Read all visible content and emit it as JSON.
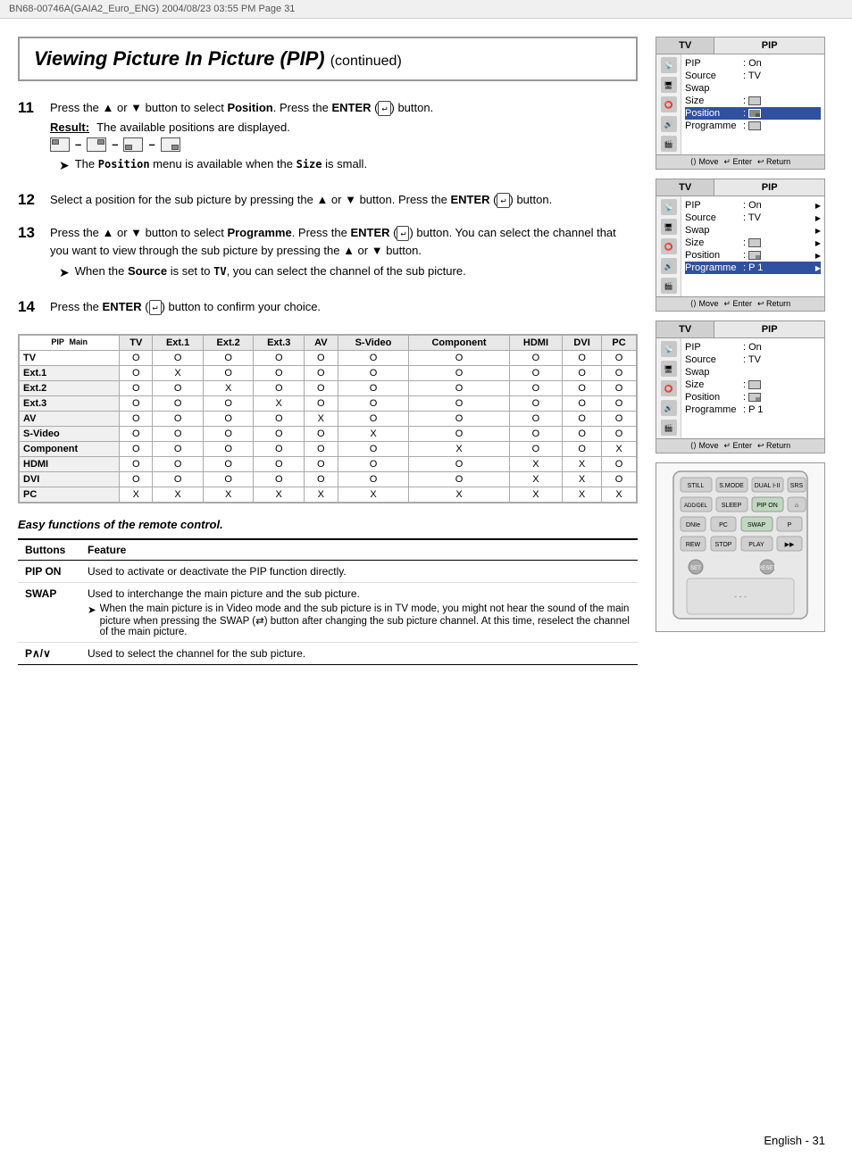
{
  "header": {
    "left_text": "BN68-00746A(GAIA2_Euro_ENG)   2004/08/23   03:55 PM   Page 31"
  },
  "title": {
    "main": "Viewing Picture In Picture (PIP)",
    "continued": "(continued)"
  },
  "steps": [
    {
      "number": "11",
      "text": "Press the ▲ or ▼ button to select Position. Press the ENTER (↵) button.",
      "result_label": "Result:",
      "result_text": "The available positions are displayed.",
      "note": "The Position menu is available when the Size is small."
    },
    {
      "number": "12",
      "text": "Select a position for the sub picture by pressing the ▲ or ▼ button. Press the ENTER (↵) button."
    },
    {
      "number": "13",
      "text": "Press the ▲ or ▼ button to select Programme. Press the ENTER (↵) button. You can select the channel that you want to view through the sub picture by pressing the ▲ or ▼ button.",
      "note": "When the Source is set to TV, you can select the channel of the sub picture."
    },
    {
      "number": "14",
      "text": "Press the ENTER (↵) button to confirm your choice."
    }
  ],
  "pip_table": {
    "corner_label": "PIP  Main",
    "columns": [
      "TV",
      "Ext.1",
      "Ext.2",
      "Ext.3",
      "AV",
      "S-Video",
      "Component",
      "HDMI",
      "DVI",
      "PC"
    ],
    "rows": [
      {
        "label": "TV",
        "values": [
          "O",
          "O",
          "O",
          "O",
          "O",
          "O",
          "O",
          "O",
          "O",
          "O"
        ]
      },
      {
        "label": "Ext.1",
        "values": [
          "O",
          "X",
          "O",
          "O",
          "O",
          "O",
          "O",
          "O",
          "O",
          "O"
        ]
      },
      {
        "label": "Ext.2",
        "values": [
          "O",
          "O",
          "X",
          "O",
          "O",
          "O",
          "O",
          "O",
          "O",
          "O"
        ]
      },
      {
        "label": "Ext.3",
        "values": [
          "O",
          "O",
          "O",
          "X",
          "O",
          "O",
          "O",
          "O",
          "O",
          "O"
        ]
      },
      {
        "label": "AV",
        "values": [
          "O",
          "O",
          "O",
          "O",
          "X",
          "O",
          "O",
          "O",
          "O",
          "O"
        ]
      },
      {
        "label": "S-Video",
        "values": [
          "O",
          "O",
          "O",
          "O",
          "O",
          "X",
          "O",
          "O",
          "O",
          "O"
        ]
      },
      {
        "label": "Component",
        "values": [
          "O",
          "O",
          "O",
          "O",
          "O",
          "O",
          "X",
          "O",
          "O",
          "X"
        ]
      },
      {
        "label": "HDMI",
        "values": [
          "O",
          "O",
          "O",
          "O",
          "O",
          "O",
          "O",
          "X",
          "X",
          "O"
        ]
      },
      {
        "label": "DVI",
        "values": [
          "O",
          "O",
          "O",
          "O",
          "O",
          "O",
          "O",
          "X",
          "X",
          "O"
        ]
      },
      {
        "label": "PC",
        "values": [
          "X",
          "X",
          "X",
          "X",
          "X",
          "X",
          "X",
          "X",
          "X",
          "X"
        ]
      }
    ]
  },
  "remote_section": {
    "title": "Easy functions of the remote control.",
    "col_buttons": "Buttons",
    "col_feature": "Feature",
    "rows": [
      {
        "button": "PIP ON",
        "feature": "Used to activate or deactivate the PIP function directly."
      },
      {
        "button": "SWAP",
        "feature": "Used to interchange the main picture and the sub picture.",
        "note": "When the main picture is in Video mode and the sub picture is in TV mode, you might not hear the sound of the main picture when pressing the SWAP (⇄) button after changing the sub picture channel. At this time, reselect the channel of the main picture."
      },
      {
        "button": "P∧/∨",
        "feature": "Used to select the channel for the sub picture."
      }
    ]
  },
  "osd_panels": [
    {
      "tv_label": "TV",
      "pip_label": "PIP",
      "rows": [
        {
          "label": "PIP",
          "value": ": On",
          "arrow": false
        },
        {
          "label": "Source",
          "value": ": TV",
          "arrow": false
        },
        {
          "label": "Swap",
          "value": "",
          "arrow": false
        },
        {
          "label": "Size",
          "value": ":",
          "arrow": false,
          "has_img": true
        },
        {
          "label": "Position",
          "value": ":",
          "arrow": false,
          "has_img": true,
          "highlight": true
        },
        {
          "label": "Programme",
          "value": ":",
          "arrow": false,
          "has_img": true
        }
      ],
      "footer": "⟨⟩ Move  ↵ Enter  ↩ Return"
    },
    {
      "tv_label": "TV",
      "pip_label": "PIP",
      "rows": [
        {
          "label": "PIP",
          "value": ": On",
          "arrow": true
        },
        {
          "label": "Source",
          "value": ": TV",
          "arrow": true
        },
        {
          "label": "Swap",
          "value": "",
          "arrow": true
        },
        {
          "label": "Size",
          "value": ":",
          "arrow": true,
          "has_img": true
        },
        {
          "label": "Position",
          "value": ":",
          "arrow": true,
          "has_img": true
        },
        {
          "label": "Programme",
          "value": ": P 1",
          "arrow": true,
          "highlight": true
        }
      ],
      "footer": "⟨⟩ Move  ↵ Enter  ↩ Return"
    },
    {
      "tv_label": "TV",
      "pip_label": "PIP",
      "rows": [
        {
          "label": "PIP",
          "value": ": On",
          "arrow": false
        },
        {
          "label": "Source",
          "value": ": TV",
          "arrow": false
        },
        {
          "label": "Swap",
          "value": "",
          "arrow": false
        },
        {
          "label": "Size",
          "value": ":",
          "arrow": false,
          "has_img": true
        },
        {
          "label": "Position",
          "value": ":",
          "arrow": false,
          "has_img": true
        },
        {
          "label": "Programme",
          "value": ": P 1",
          "arrow": false
        }
      ],
      "footer": "⟨⟩ Move  ↵ Enter  ↩ Return"
    }
  ],
  "footer": {
    "language": "English",
    "page": "31",
    "label": "English - 31"
  }
}
